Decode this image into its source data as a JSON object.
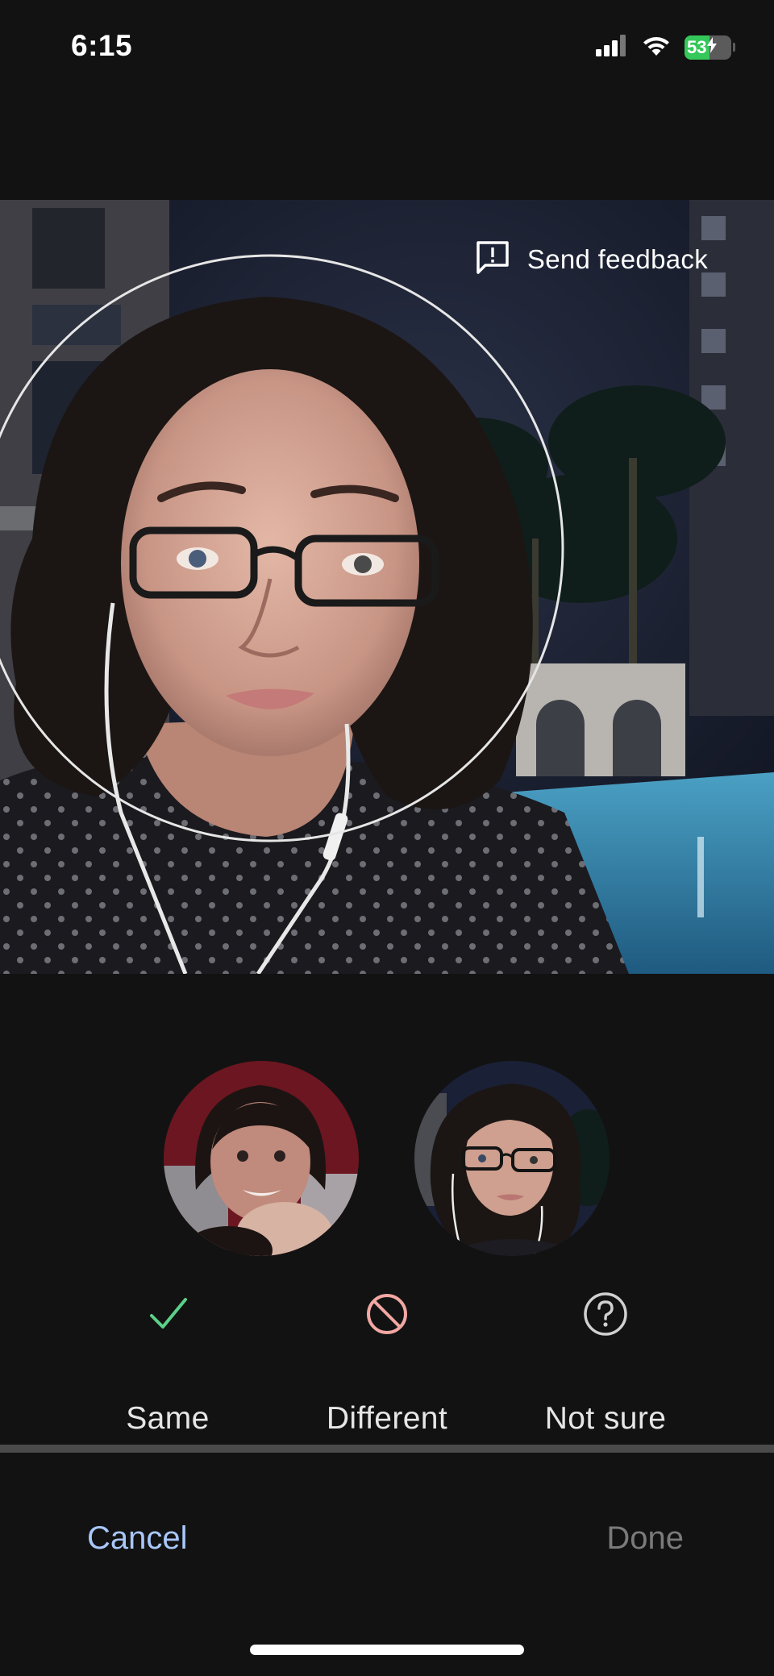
{
  "status_bar": {
    "time": "6:15",
    "battery_level": "53",
    "battery_fraction": 0.53,
    "signal_icon": "cellular-signal-icon",
    "wifi_icon": "wifi-icon",
    "charging_icon": "bolt-icon"
  },
  "photo": {
    "feedback_label": "Send feedback",
    "feedback_icon": "feedback-icon"
  },
  "choices": {
    "same": {
      "label": "Same",
      "icon": "check-icon",
      "color": "#5bd08a"
    },
    "different": {
      "label": "Different",
      "icon": "block-icon",
      "color": "#f2a7a3"
    },
    "not_sure": {
      "label": "Not sure",
      "icon": "help-circle-icon",
      "color": "#d0d0d0"
    }
  },
  "actions": {
    "cancel_label": "Cancel",
    "done_label": "Done"
  },
  "colors": {
    "background": "#121212",
    "accent": "#a8c7fa",
    "disabled": "#7a7a7a"
  }
}
